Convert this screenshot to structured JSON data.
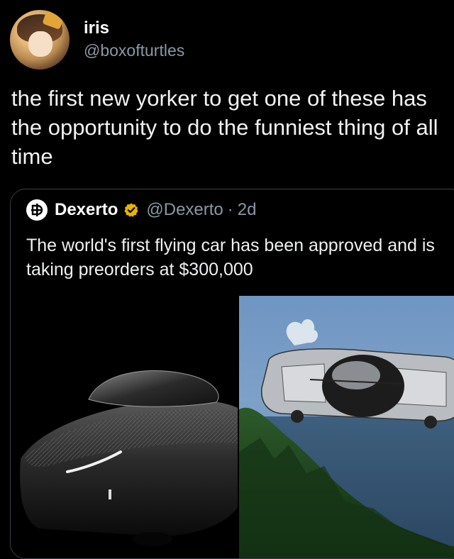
{
  "tweet": {
    "display_name": "iris",
    "handle": "@boxofturtles",
    "text": "the first new yorker to get one of these has the opportunity to do the funniest thing of all time"
  },
  "quote": {
    "name": "Dexerto",
    "handle": "@Dexerto",
    "separator": "·",
    "time": "2d",
    "text": "The world's first flying car has been approved and is taking preorders at $300,000"
  },
  "icons": {
    "avatar": "avatar-anime-girl",
    "source_logo": "dexerto-logo",
    "verified": "verified-badge-icon"
  },
  "colors": {
    "background": "#000000",
    "secondary_text": "#8b98a5",
    "verified": "#e8b400"
  }
}
